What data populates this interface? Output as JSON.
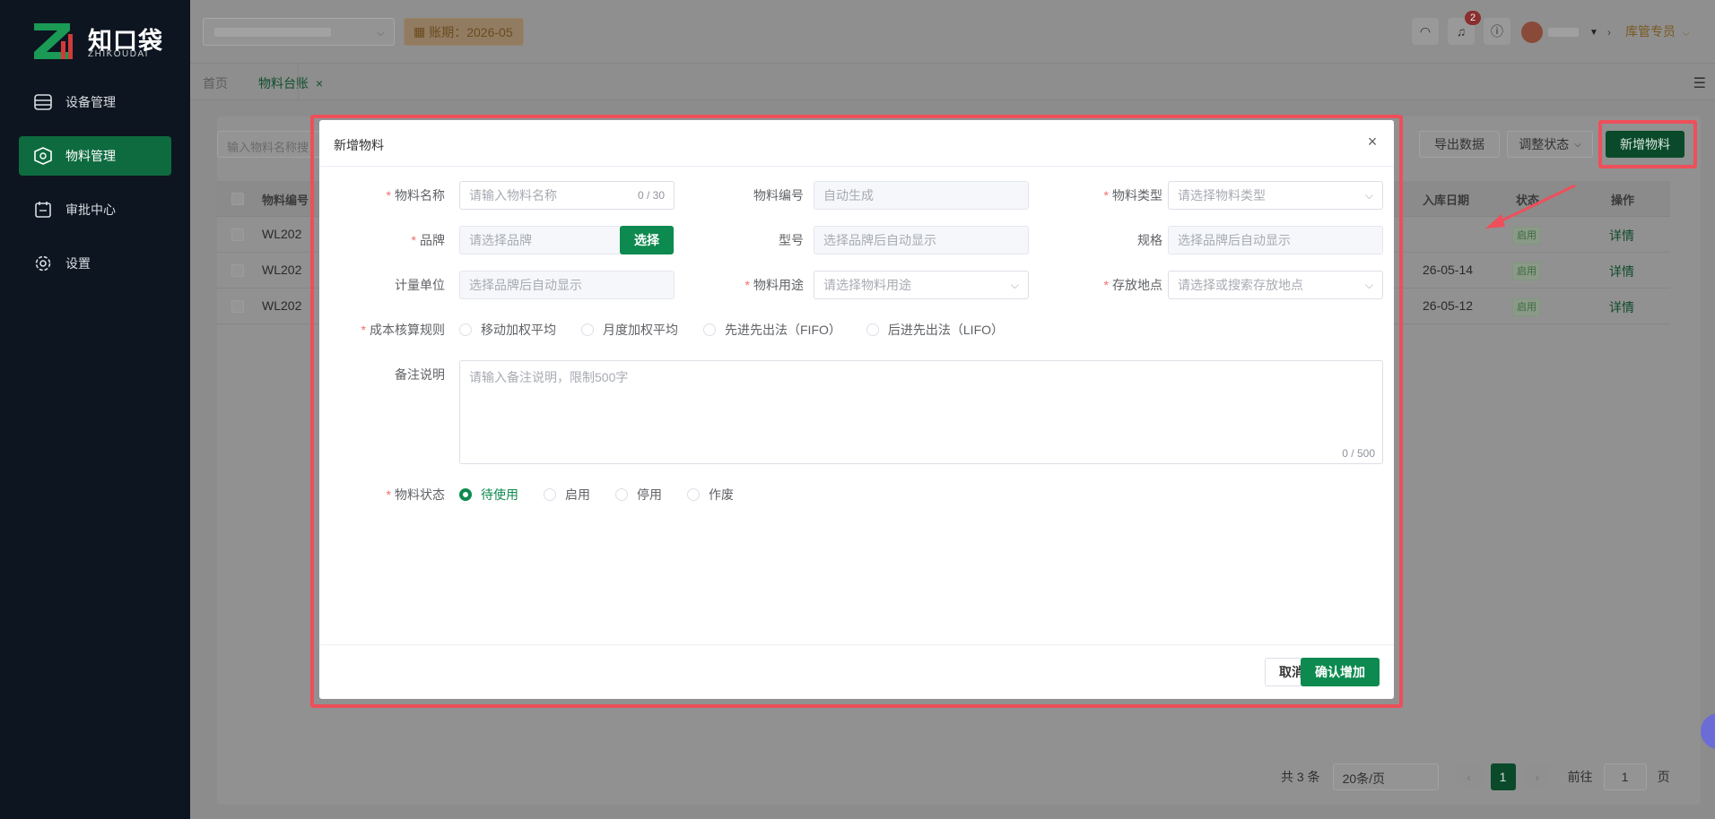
{
  "brand": {
    "name": "知口袋",
    "sub": "ZHIKOUDAI"
  },
  "sidebar": {
    "items": [
      {
        "label": "设备管理",
        "icon": "device-icon",
        "active": false
      },
      {
        "label": "物料管理",
        "icon": "box-icon",
        "active": true
      },
      {
        "label": "审批中心",
        "icon": "approval-icon",
        "active": false
      },
      {
        "label": "设置",
        "icon": "gear-icon",
        "active": false
      }
    ]
  },
  "header": {
    "period": "账期：2026-05",
    "badge_count": "2",
    "role": "库管专员"
  },
  "tabs": [
    {
      "label": "首页"
    },
    {
      "label": "物料台账",
      "close": "×"
    }
  ],
  "toolbar": {
    "search_placeholder": "输入物料名称搜",
    "export": "导出数据",
    "adjust": "调整状态",
    "add": "新增物料"
  },
  "table": {
    "headers": [
      "物料编号",
      "入库日期",
      "状态",
      "操作"
    ],
    "rows": [
      {
        "code": "WL202",
        "date": "",
        "status": "启用",
        "action": "详情"
      },
      {
        "code": "WL202",
        "date": "26-05-14",
        "status": "启用",
        "action": "详情"
      },
      {
        "code": "WL202",
        "date": "26-05-12",
        "status": "启用",
        "action": "详情"
      }
    ]
  },
  "pagination": {
    "total": "共 3 条",
    "page_size": "20条/页",
    "current": "1",
    "goto_label": "前往",
    "goto_value": "1",
    "page_unit": "页"
  },
  "modal": {
    "title": "新增物料",
    "close": "×",
    "fields": {
      "name": {
        "label": "物料名称",
        "placeholder": "请输入物料名称",
        "count": "0 / 30"
      },
      "code": {
        "label": "物料编号",
        "placeholder": "自动生成"
      },
      "type": {
        "label": "物料类型",
        "placeholder": "请选择物料类型"
      },
      "brand": {
        "label": "品牌",
        "placeholder": "请选择品牌",
        "button": "选择"
      },
      "model": {
        "label": "型号",
        "placeholder": "选择品牌后自动显示"
      },
      "spec": {
        "label": "规格",
        "placeholder": "选择品牌后自动显示"
      },
      "unit": {
        "label": "计量单位",
        "placeholder": "选择品牌后自动显示"
      },
      "usage": {
        "label": "物料用途",
        "placeholder": "请选择物料用途"
      },
      "location": {
        "label": "存放地点",
        "placeholder": "请选择或搜索存放地点"
      },
      "cost_rule": {
        "label": "成本核算规则",
        "options": [
          "移动加权平均",
          "月度加权平均",
          "先进先出法（FIFO）",
          "后进先出法（LIFO）"
        ]
      },
      "remark": {
        "label": "备注说明",
        "placeholder": "请输入备注说明，限制500字",
        "count": "0 / 500"
      },
      "status": {
        "label": "物料状态",
        "options": [
          "待使用",
          "启用",
          "停用",
          "作废"
        ],
        "selected": "待使用"
      }
    },
    "cancel": "取消",
    "confirm": "确认增加"
  },
  "colors": {
    "accent": "#0d8a4f",
    "sidebar_bg": "#0d1520",
    "highlight": "#ee4f5a"
  }
}
